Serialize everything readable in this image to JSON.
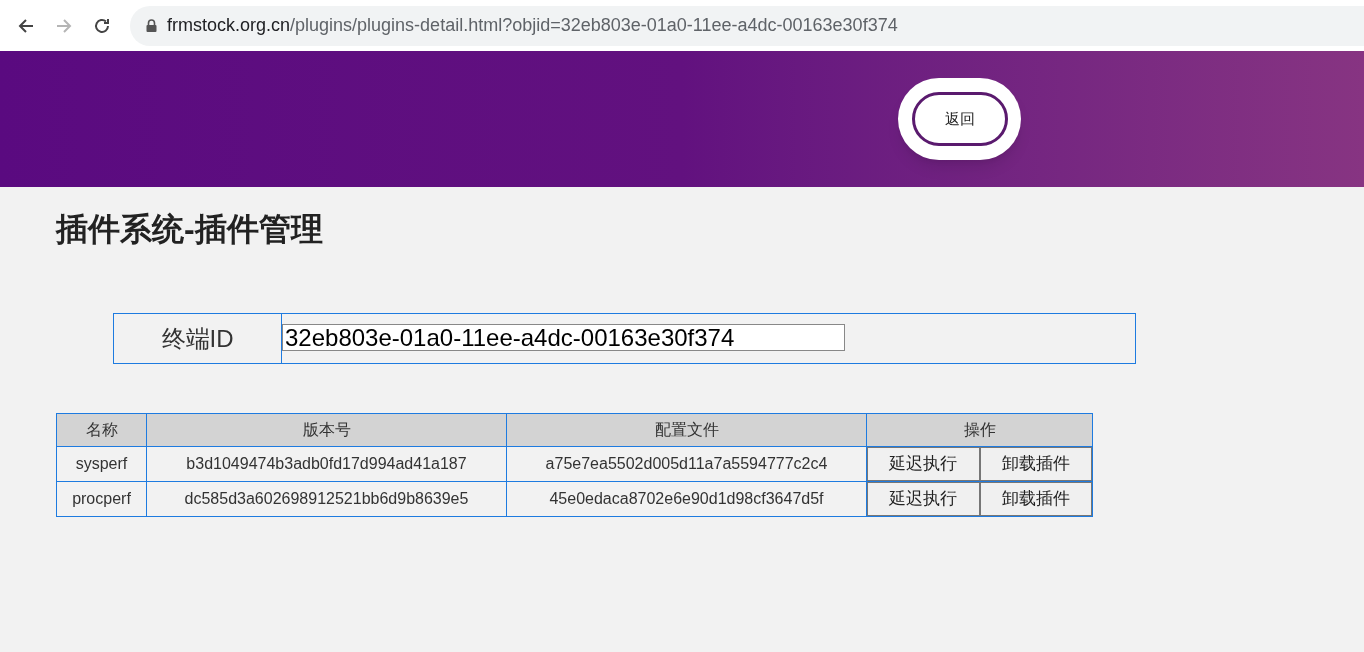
{
  "browser": {
    "url_host": "frmstock.org.cn",
    "url_path": "/plugins/plugins-detail.html?objid=32eb803e-01a0-11ee-a4dc-00163e30f374",
    "forward_disabled": true
  },
  "header": {
    "back_button": "返回"
  },
  "page_title": "插件系统-插件管理",
  "terminal": {
    "label": "终端ID",
    "value": "32eb803e-01a0-11ee-a4dc-00163e30f374"
  },
  "table": {
    "columns": [
      "名称",
      "版本号",
      "配置文件",
      "操作"
    ],
    "rows": [
      {
        "name": "sysperf",
        "version": "b3d1049474b3adb0fd17d994ad41a187",
        "config": "a75e7ea5502d005d11a7a5594777c2c4",
        "actions": [
          "延迟执行",
          "卸载插件"
        ]
      },
      {
        "name": "procperf",
        "version": "dc585d3a602698912521bb6d9b8639e5",
        "config": "45e0edaca8702e6e90d1d98cf3647d5f",
        "actions": [
          "延迟执行",
          "卸载插件"
        ]
      }
    ]
  }
}
